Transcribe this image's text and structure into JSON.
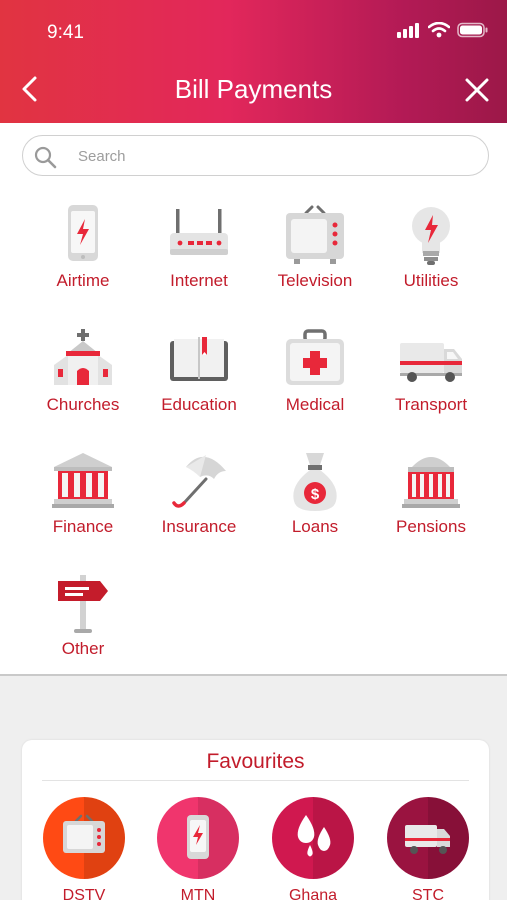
{
  "status_bar": {
    "time": "9:41"
  },
  "header": {
    "title": "Bill Payments"
  },
  "search": {
    "placeholder": "Search"
  },
  "categories": [
    {
      "label": "Airtime",
      "icon": "phone-bolt-icon"
    },
    {
      "label": "Internet",
      "icon": "router-icon"
    },
    {
      "label": "Television",
      "icon": "tv-icon"
    },
    {
      "label": "Utilities",
      "icon": "lightbulb-icon"
    },
    {
      "label": "Churches",
      "icon": "church-icon"
    },
    {
      "label": "Education",
      "icon": "book-icon"
    },
    {
      "label": "Medical",
      "icon": "medical-kit-icon"
    },
    {
      "label": "Transport",
      "icon": "truck-icon"
    },
    {
      "label": "Finance",
      "icon": "bank-icon"
    },
    {
      "label": "Insurance",
      "icon": "umbrella-icon"
    },
    {
      "label": "Loans",
      "icon": "money-bag-icon"
    },
    {
      "label": "Pensions",
      "icon": "pension-building-icon"
    },
    {
      "label": "Other",
      "icon": "signpost-icon"
    }
  ],
  "favourites": {
    "title": "Favourites",
    "items": [
      {
        "label": "DSTV",
        "icon": "tv-icon",
        "color": "#ff4a14"
      },
      {
        "label": "MTN",
        "icon": "phone-bolt-icon",
        "color": "#f0356d"
      },
      {
        "label": "Ghana",
        "icon": "water-drops-icon",
        "color": "#d0184f"
      },
      {
        "label": "STC",
        "icon": "truck-icon",
        "color": "#9a1340"
      }
    ]
  },
  "colors": {
    "accent": "#c21c2b",
    "header_start": "#e13441",
    "header_end": "#9c1848"
  }
}
